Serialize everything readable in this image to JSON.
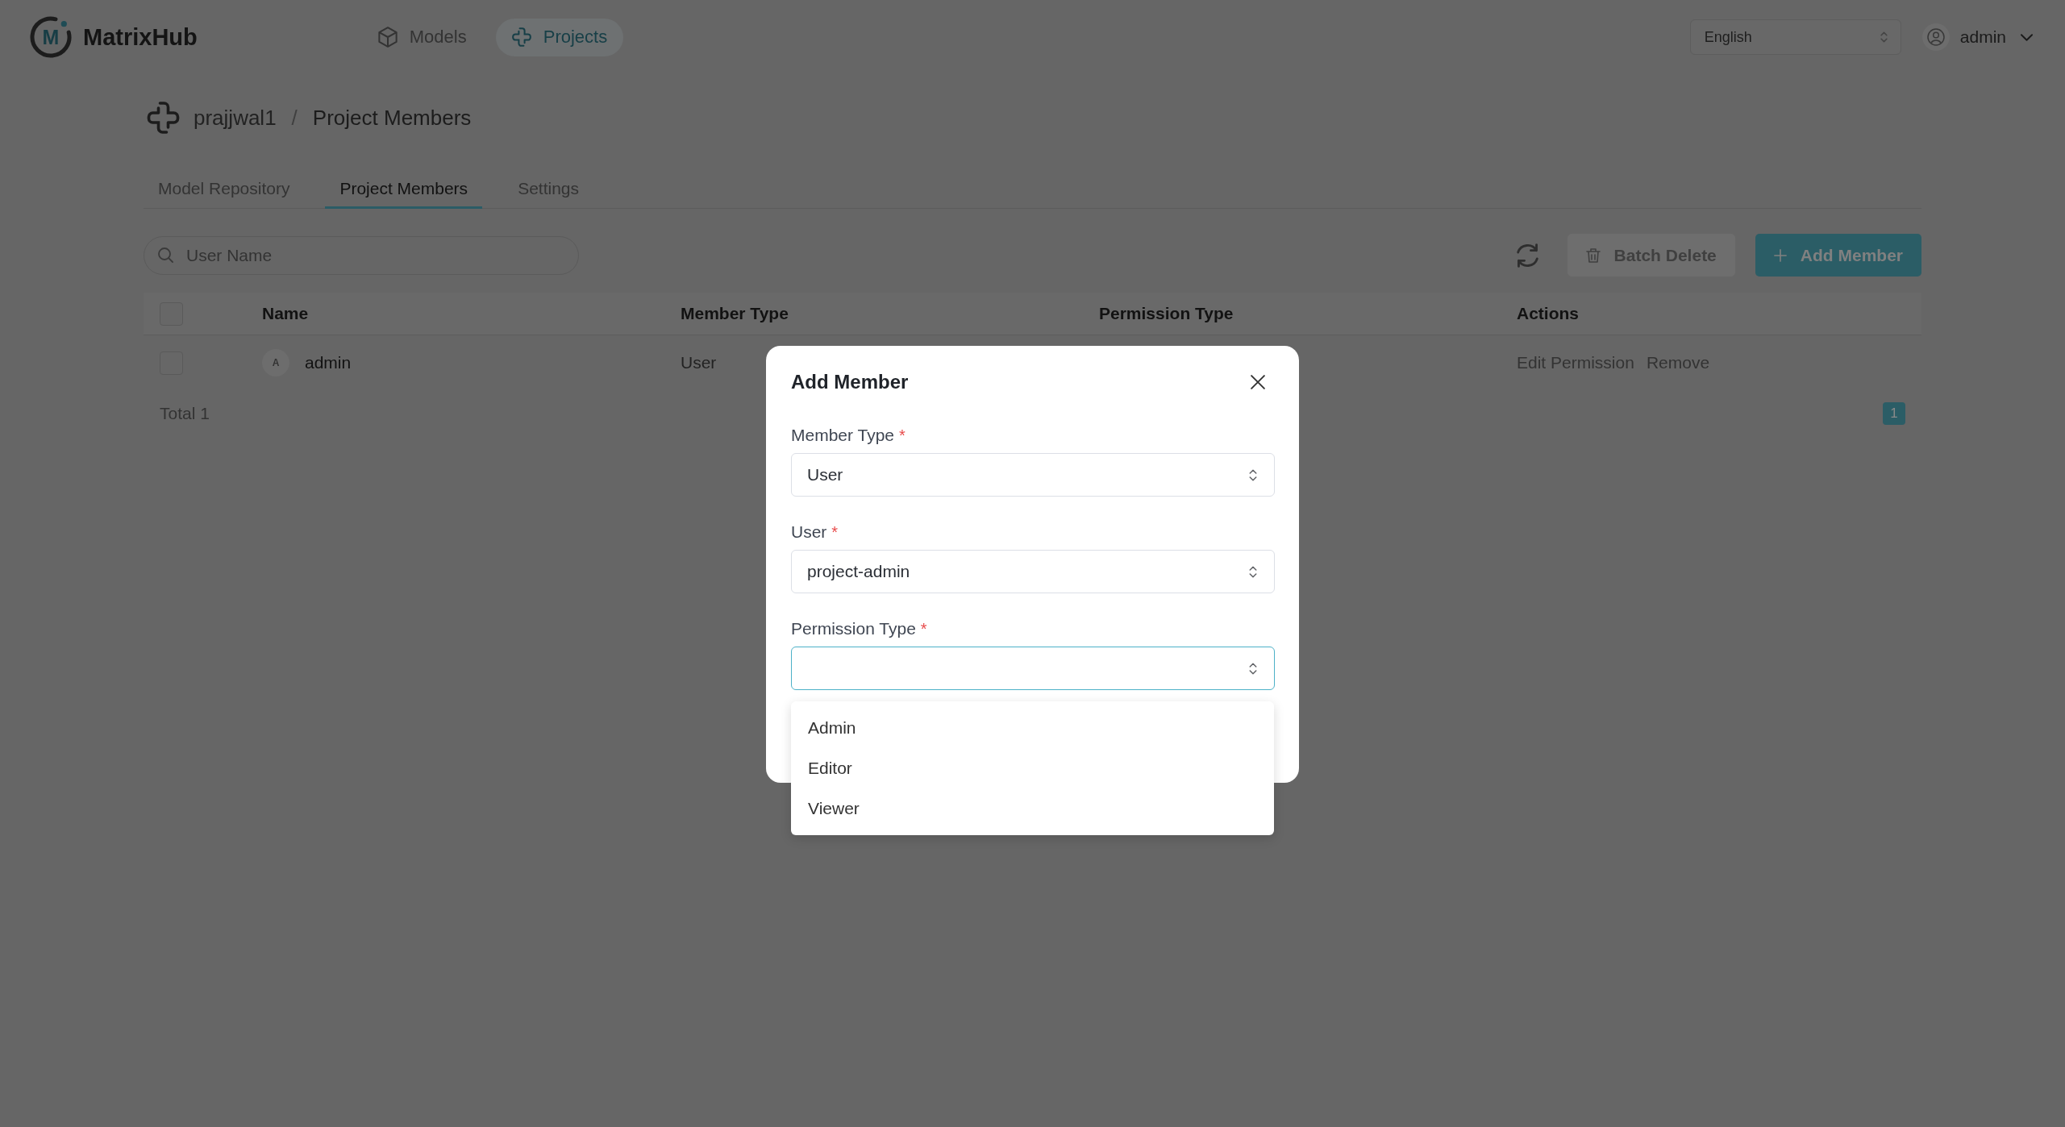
{
  "header": {
    "logo_mark": "M",
    "app_name": "MatrixHub",
    "nav": [
      {
        "label": "Models",
        "kind": "cube",
        "selected": false
      },
      {
        "label": "Projects",
        "kind": "knot",
        "selected": true
      }
    ],
    "language": "English",
    "user": "admin"
  },
  "breadcrumb": {
    "project": "prajjwal1",
    "separator": "/",
    "page": "Project Members"
  },
  "tabs": [
    {
      "label": "Model Repository",
      "selected": false
    },
    {
      "label": "Project Members",
      "selected": true
    },
    {
      "label": "Settings",
      "selected": false
    }
  ],
  "toolbar": {
    "search_placeholder": "User Name",
    "buttons": [
      {
        "label": "Batch Delete",
        "kind": "delete",
        "disabled": true
      },
      {
        "label": "Add Member",
        "kind": "add",
        "disabled": false
      }
    ]
  },
  "table": {
    "select_all_checked": false,
    "columns": [
      "Name",
      "Member Type",
      "Permission Type",
      "Actions"
    ],
    "rows": [
      {
        "checked": false,
        "avatar": "A",
        "name": "admin",
        "member_type": "User",
        "actions": [
          "Edit Permission",
          "Remove"
        ]
      }
    ]
  },
  "footer": {
    "total": "Total 1",
    "pages": [
      {
        "label": "1",
        "selected": true
      }
    ]
  },
  "modal": {
    "title": "Add Member",
    "fields": [
      {
        "label": "Member Type",
        "required_mark": "*",
        "value": "User",
        "focused": false
      },
      {
        "label": "User",
        "required_mark": "*",
        "value": "project-admin",
        "focused": false
      },
      {
        "label": "Permission Type",
        "required_mark": "*",
        "focused": true
      }
    ],
    "dropdown": {
      "options": [
        {
          "label": "Admin",
          "selected": false
        },
        {
          "label": "Editor",
          "selected": false
        },
        {
          "label": "Viewer",
          "selected": false
        }
      ]
    }
  }
}
